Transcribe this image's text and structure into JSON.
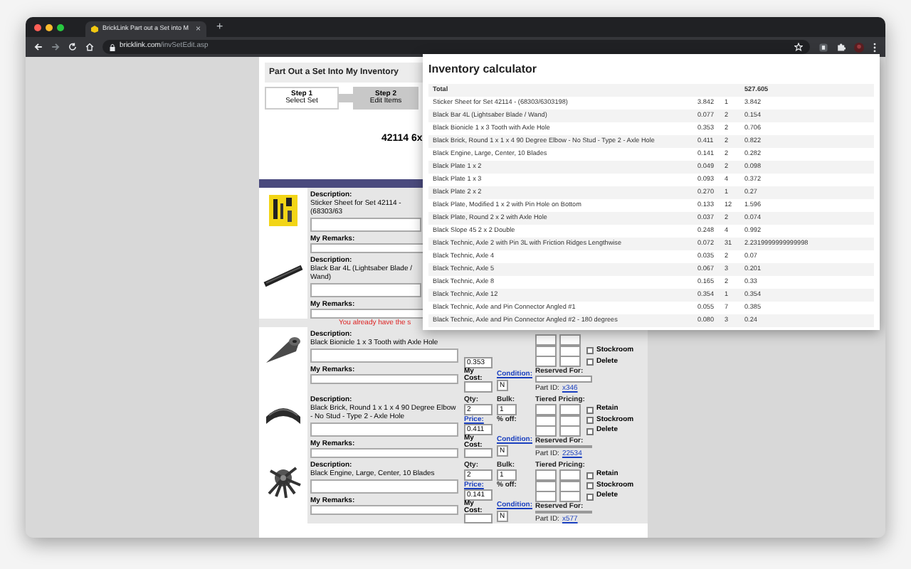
{
  "browser": {
    "tab_title": "BrickLink Part out a Set into M",
    "tab_close": "×",
    "new_tab": "+",
    "url_host": "bricklink.com",
    "url_path": "/invSetEdit.asp"
  },
  "page": {
    "heading": "Part Out a Set Into My Inventory",
    "steps": [
      {
        "label": "Step 1",
        "caption": "Select Set",
        "selected": false
      },
      {
        "label": "Step 2",
        "caption": "Edit Items",
        "selected": true
      }
    ],
    "set_title": "42114 6x",
    "items": [
      {
        "kind": "picture",
        "description_label": "Description:",
        "description": "Sticker Sheet for Set 42114 - (68303/63",
        "remarks_label": "My Remarks:"
      },
      {
        "kind": "picture",
        "description_label": "Description:",
        "description": "Black Bar 4L (Lightsaber Blade / Wand)",
        "remarks_label": "My Remarks:",
        "warning": "You already have the s"
      },
      {
        "kind": "picture",
        "description_label": "Description:",
        "description": "Black Bionicle 1 x 3 Tooth with Axle Hole",
        "remarks_label": "My Remarks:",
        "fields": {
          "price": "0.353",
          "my_cost_label": "My Cost:",
          "condition_label": "Condition:",
          "condition": "N",
          "reserved_label": "Reserved For:",
          "part_id_label": "Part ID:",
          "part_id": "x346",
          "checkboxes": [
            {
              "label": "Stockroom",
              "checked": false
            },
            {
              "label": "Delete",
              "checked": false
            }
          ]
        }
      },
      {
        "kind": "picture",
        "description_label": "Description:",
        "description": "Black Brick, Round 1 x 1 x 4 90 Degree Elbow - No Stud - Type 2 - Axle Hole",
        "remarks_label": "My Remarks:",
        "fields": {
          "qty_label": "Qty:",
          "qty": "2",
          "bulk_label": "Bulk:",
          "bulk": "1",
          "price_label": "Price:",
          "price": "0.411",
          "discount_label": "% off:",
          "my_cost_label": "My Cost:",
          "condition_label": "Condition:",
          "condition": "N",
          "tiered_label": "Tiered Pricing:",
          "reserved_label": "Reserved For:",
          "part_id_label": "Part ID:",
          "part_id": "22534",
          "checkboxes": [
            {
              "label": "Retain",
              "checked": false
            },
            {
              "label": "Stockroom",
              "checked": false
            },
            {
              "label": "Delete",
              "checked": false
            }
          ]
        }
      },
      {
        "kind": "picture",
        "description_label": "Description:",
        "description": "Black Engine, Large, Center, 10 Blades",
        "remarks_label": "My Remarks:",
        "fields": {
          "qty_label": "Qty:",
          "qty": "2",
          "bulk_label": "Bulk:",
          "bulk": "1",
          "price_label": "Price:",
          "price": "0.141",
          "discount_label": "% off:",
          "my_cost_label": "My Cost:",
          "condition_label": "Condition:",
          "condition": "N",
          "tiered_label": "Tiered Pricing:",
          "reserved_label": "Reserved For:",
          "part_id_label": "Part ID:",
          "part_id": "x577",
          "checkboxes": [
            {
              "label": "Retain",
              "checked": false
            },
            {
              "label": "Stockroom",
              "checked": false
            },
            {
              "label": "Delete",
              "checked": false
            }
          ]
        }
      }
    ]
  },
  "calculator": {
    "title": "Inventory calculator",
    "total_label": "Total",
    "total": "527.605",
    "rows": [
      {
        "name": "Sticker Sheet for Set 42114 - (68303/6303198)",
        "price": "3.842",
        "qty": "1",
        "total": "3.842"
      },
      {
        "name": "Black Bar 4L (Lightsaber Blade / Wand)",
        "price": "0.077",
        "qty": "2",
        "total": "0.154"
      },
      {
        "name": "Black Bionicle 1 x 3 Tooth with Axle Hole",
        "price": "0.353",
        "qty": "2",
        "total": "0.706"
      },
      {
        "name": "Black Brick, Round 1 x 1 x 4 90 Degree Elbow - No Stud - Type 2 - Axle Hole",
        "price": "0.411",
        "qty": "2",
        "total": "0.822"
      },
      {
        "name": "Black Engine, Large, Center, 10 Blades",
        "price": "0.141",
        "qty": "2",
        "total": "0.282"
      },
      {
        "name": "Black Plate 1 x 2",
        "price": "0.049",
        "qty": "2",
        "total": "0.098"
      },
      {
        "name": "Black Plate 1 x 3",
        "price": "0.093",
        "qty": "4",
        "total": "0.372"
      },
      {
        "name": "Black Plate 2 x 2",
        "price": "0.270",
        "qty": "1",
        "total": "0.27"
      },
      {
        "name": "Black Plate, Modified 1 x 2 with Pin Hole on Bottom",
        "price": "0.133",
        "qty": "12",
        "total": "1.596"
      },
      {
        "name": "Black Plate, Round 2 x 2 with Axle Hole",
        "price": "0.037",
        "qty": "2",
        "total": "0.074"
      },
      {
        "name": "Black Slope 45 2 x 2 Double",
        "price": "0.248",
        "qty": "4",
        "total": "0.992"
      },
      {
        "name": "Black Technic, Axle 2 with Pin 3L with Friction Ridges Lengthwise",
        "price": "0.072",
        "qty": "31",
        "total": "2.2319999999999998"
      },
      {
        "name": "Black Technic, Axle 4",
        "price": "0.035",
        "qty": "2",
        "total": "0.07"
      },
      {
        "name": "Black Technic, Axle 5",
        "price": "0.067",
        "qty": "3",
        "total": "0.201"
      },
      {
        "name": "Black Technic, Axle 8",
        "price": "0.165",
        "qty": "2",
        "total": "0.33"
      },
      {
        "name": "Black Technic, Axle 12",
        "price": "0.354",
        "qty": "1",
        "total": "0.354"
      },
      {
        "name": "Black Technic, Axle and Pin Connector Angled #1",
        "price": "0.055",
        "qty": "7",
        "total": "0.385"
      },
      {
        "name": "Black Technic, Axle and Pin Connector Angled #2 - 180 degrees",
        "price": "0.080",
        "qty": "3",
        "total": "0.24"
      }
    ]
  }
}
